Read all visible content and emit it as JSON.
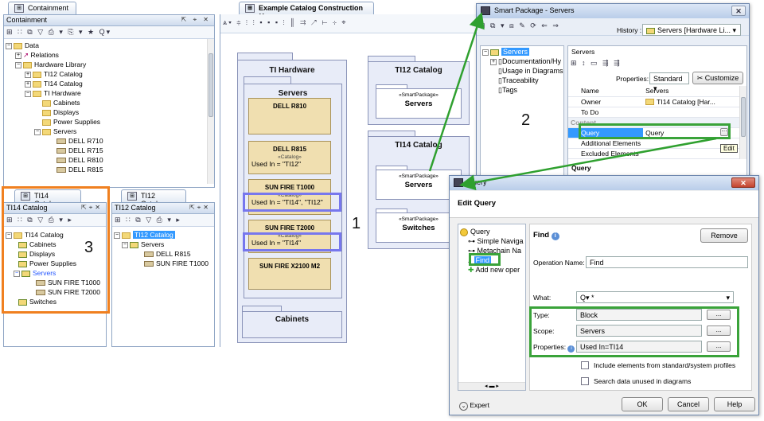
{
  "containment": {
    "tab": "Containment",
    "title": "Containment",
    "items": [
      "Data",
      "Relations",
      "Hardware Library",
      "TI12 Catalog",
      "TI14 Catalog",
      "TI Hardware",
      "Cabinets",
      "Displays",
      "Power Supplies",
      "Servers",
      "DELL R710",
      "DELL R715",
      "DELL R810",
      "DELL R815"
    ]
  },
  "ti14_panel": {
    "tab": "TI14 Catalog",
    "title": "TI14 Catalog",
    "items": [
      "TI14 Catalog",
      "Cabinets",
      "Displays",
      "Power Supplies",
      "Servers",
      "SUN FIRE T1000",
      "SUN FIRE T2000",
      "Switches"
    ]
  },
  "ti12_panel": {
    "tab": "TI12 Catalog",
    "title": "TI12 Catalog",
    "items": [
      "TI12 Catalog",
      "Servers",
      "DELL R815",
      "SUN FIRE T1000"
    ]
  },
  "diagram": {
    "tab": "Example Catalog Construction",
    "ti_hardware": "TI Hardware",
    "servers": "Servers",
    "blocks": [
      {
        "name": "DELL R810",
        "stereo": "",
        "tagged": ""
      },
      {
        "name": "DELL R815",
        "stereo": "«Catalog»",
        "tagged": "Used In = \"TI12\""
      },
      {
        "name": "SUN FIRE T1000",
        "stereo": "«Catalog»",
        "tagged": "Used In = \"TI14\", \"TI12\""
      },
      {
        "name": "SUN FIRE T2000",
        "stereo": "«Catalog»",
        "tagged": "Used In = \"TI14\""
      },
      {
        "name": "SUN FIRE X2100 M2",
        "stereo": "",
        "tagged": ""
      }
    ],
    "cabinets": "Cabinets",
    "ti12_catalog": "TI12 Catalog",
    "ti14_catalog": "TI14 Catalog",
    "smart_stereo": "«SmartPackage»",
    "ti12_servers": "Servers",
    "ti14_servers": "Servers",
    "ti14_switches": "Switches"
  },
  "numbers": {
    "one": "1",
    "two": "2",
    "three": "3"
  },
  "smart_pkg": {
    "title": "Smart Package - Servers",
    "history_label": "History :",
    "history_value": "Servers [Hardware Li...",
    "tree": [
      "Servers",
      "Documentation/Hy",
      "Usage in Diagrams",
      "Traceability",
      "Tags"
    ],
    "panel_title": "Servers",
    "properties_label": "Properties:",
    "properties_value": "Standard",
    "customize": "Customize",
    "rows": [
      {
        "k": "Name",
        "v": "Servers"
      },
      {
        "k": "Owner",
        "v": "TI14 Catalog [Har..."
      },
      {
        "k": "To Do",
        "v": ""
      },
      {
        "k": "Content",
        "v": ""
      },
      {
        "k": "Query",
        "v": "Query"
      },
      {
        "k": "Additional Elements",
        "v": ""
      },
      {
        "k": "Excluded Elements",
        "v": ""
      }
    ],
    "footer": "Query",
    "edit_tip": "Edit"
  },
  "edit_query": {
    "title": "Query",
    "header": "Edit Query",
    "tree": [
      "Query",
      "Simple Naviga",
      "Metachain Na",
      "Find",
      "Add new oper"
    ],
    "find_title": "Find",
    "remove": "Remove",
    "op_name_label": "Operation Name:",
    "op_name_value": "Find",
    "what_label": "What:",
    "what_value": "Q▾ *",
    "type_label": "Type:",
    "type_value": "Block",
    "scope_label": "Scope:",
    "scope_value": "Servers",
    "props_label": "Properties:",
    "props_value": "Used In=TI14",
    "dots": "...",
    "chk1": "Include elements from standard/system profiles",
    "chk2": "Search data unused in diagrams",
    "expert": "Expert",
    "ok": "OK",
    "cancel": "Cancel",
    "help": "Help"
  }
}
